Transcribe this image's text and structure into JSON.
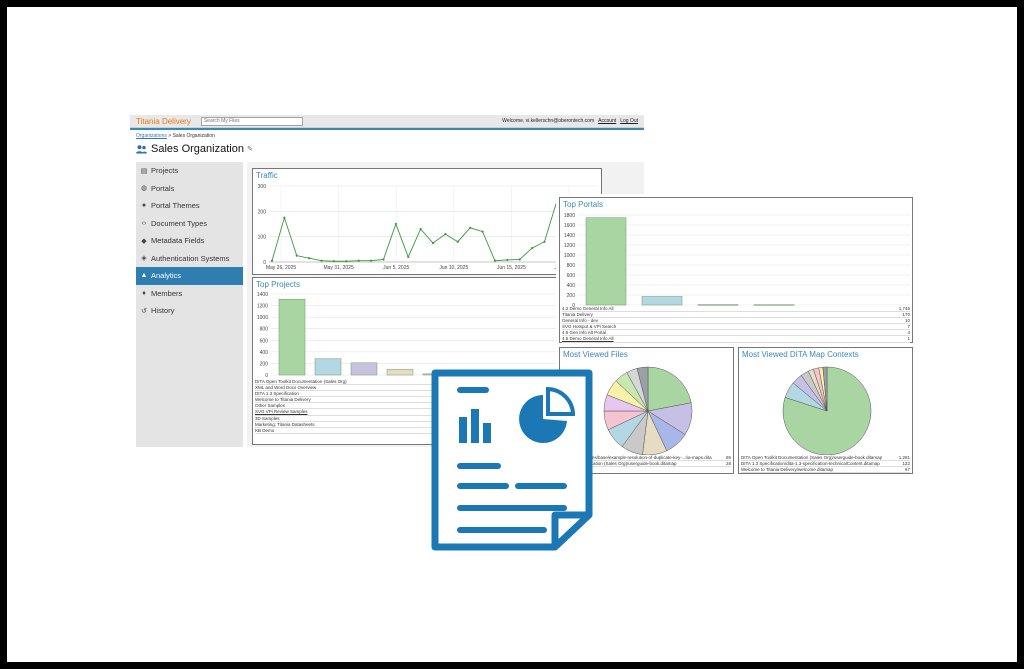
{
  "app": {
    "brand": "Titania Delivery",
    "search_placeholder": "Search My Files",
    "welcome": "Welcome, vi.kellerschn@oberontech.com",
    "account": "Account",
    "logout": "Log Out",
    "breadcrumb_root": "Organizations",
    "breadcrumb_sep": ">",
    "breadcrumb_current": "Sales Organization",
    "org_title": "Sales Organization"
  },
  "sidebar": {
    "items": [
      {
        "label": "Projects",
        "icon": "file-icon"
      },
      {
        "label": "Portals",
        "icon": "globe-icon"
      },
      {
        "label": "Portal Themes",
        "icon": "palette-icon"
      },
      {
        "label": "Document Types",
        "icon": "code-icon"
      },
      {
        "label": "Metadata Fields",
        "icon": "tag-icon"
      },
      {
        "label": "Authentication Systems",
        "icon": "shield-icon"
      },
      {
        "label": "Analytics",
        "icon": "chart-icon",
        "active": true
      },
      {
        "label": "Members",
        "icon": "users-icon"
      },
      {
        "label": "History",
        "icon": "history-icon"
      }
    ]
  },
  "chart_data": [
    {
      "type": "line",
      "title": "Traffic",
      "ylim": [
        0,
        300
      ],
      "yticks": [
        0,
        100,
        200,
        300
      ],
      "xtick_labels": [
        "May 26, 2025",
        "May 31, 2025",
        "Jun 5, 2025",
        "Jun 10, 2025",
        "Jun 15, 2025",
        "Jun 20, 2025"
      ],
      "values": [
        5,
        175,
        25,
        15,
        5,
        3,
        3,
        5,
        5,
        10,
        150,
        20,
        130,
        75,
        110,
        80,
        135,
        120,
        5,
        8,
        10,
        55,
        80,
        240,
        185,
        5,
        8
      ],
      "grid": true,
      "color": "#3a9a3a"
    },
    {
      "type": "bar",
      "title": "Top Projects",
      "ylim": [
        0,
        1400
      ],
      "yticks": [
        0,
        200,
        400,
        600,
        800,
        1000,
        1200,
        1400
      ],
      "values": [
        1310,
        280,
        210,
        100,
        20
      ],
      "colors": [
        "#a8d5a2",
        "#b3d7e3",
        "#c9c1e0",
        "#e8dcc0",
        "#c9c1e0"
      ],
      "categories": [
        "DITA Open Toolkit Documentation (Sales Org)",
        "XML and Word Docs Overview",
        "DITA 1.3 Specification",
        "Welcome to Titania Delivery",
        "Other Samples",
        "SVG VPi Review Samples",
        "3D Samples",
        "Marketing: Titania Datasheets",
        "KB Demo"
      ]
    },
    {
      "type": "bar",
      "title": "Top Portals",
      "ylim": [
        0,
        1800
      ],
      "yticks": [
        0,
        200,
        400,
        600,
        800,
        1000,
        1200,
        1400,
        1600,
        1800
      ],
      "values": [
        1745,
        170,
        10,
        7
      ],
      "colors": [
        "#a8d5a2",
        "#b3d7e3",
        "#c9c1e0",
        "#e8dcc0"
      ],
      "categories": [
        "4.2 Demo General Info All",
        "Titania Delivery",
        "General Info - dev",
        "SVG Hotspot & VPi Search",
        "4.5 Gen Info Alt Portal",
        "4.5 Demo General Info All"
      ],
      "table_values": [
        "1,745",
        "170",
        "10",
        "7",
        "4",
        "1"
      ]
    },
    {
      "type": "pie",
      "title": "Most Viewed Files",
      "values": [
        22,
        12,
        9,
        9,
        8,
        8,
        7,
        6,
        6,
        5,
        4,
        4
      ],
      "colors": [
        "#a8d5a2",
        "#c7c0e6",
        "#a9b7e8",
        "#e6dcc2",
        "#c9c9c9",
        "#b3d7e3",
        "#f6c3d0",
        "#e7c6f0",
        "#f7f2a8",
        "#c9e8b0",
        "#d6d6d6",
        "#9aa0a6"
      ],
      "table_rows": [
        {
          "label": "...ication/archives/base/example-resolution-of-duplicate-key-...ria-maps.dita",
          "value": "65"
        },
        {
          "label": "...lkit Documentation (Sales Org)/userguide-book.ditamap",
          "value": "28"
        }
      ]
    },
    {
      "type": "pie",
      "title": "Most Viewed DITA Map Contexts",
      "values": [
        80,
        6,
        4,
        3,
        2,
        2,
        1.5,
        1.5
      ],
      "colors": [
        "#a8d5a2",
        "#b3d7e3",
        "#c7c0e6",
        "#c9c9c9",
        "#e6dcc2",
        "#f6c3d0",
        "#f7f2a8",
        "#9aa0a6"
      ],
      "table_rows": [
        {
          "label": "DITA Open Toolkit Documentation (Sales Org)/userguide-book.ditamap",
          "value": "1,281"
        },
        {
          "label": "DITA 1.3 Specification/dita-1.3-specification-technicalContent.ditamap",
          "value": "122"
        },
        {
          "label": "Welcome to Titania Delivery/welcome.ditamap",
          "value": "67"
        }
      ]
    }
  ],
  "report_icon": {
    "name": "report-document-icon",
    "color": "#1b78b5"
  }
}
